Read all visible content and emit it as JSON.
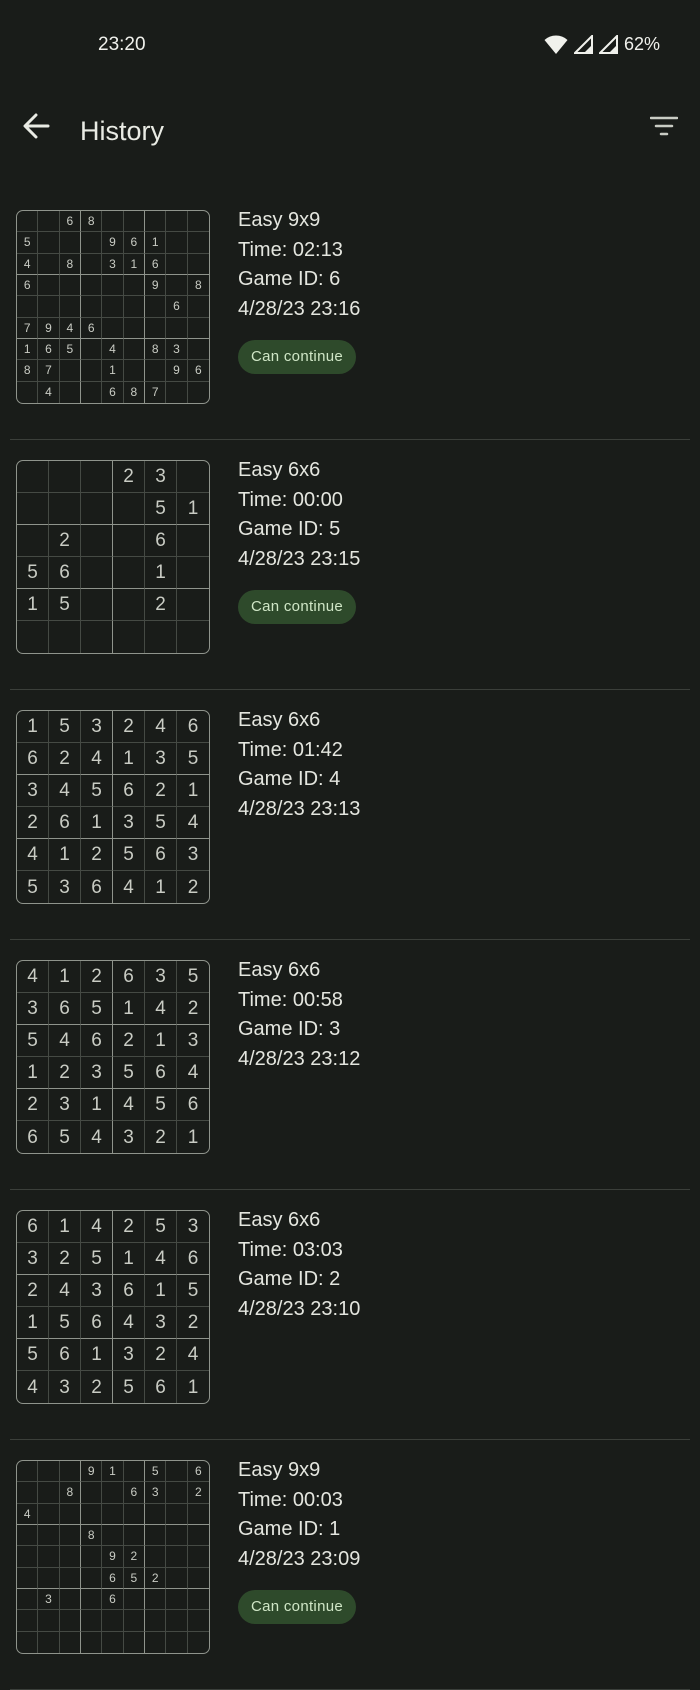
{
  "status_bar": {
    "time": "23:20",
    "battery": "62%"
  },
  "header": {
    "title": "History"
  },
  "icons": {
    "back": "arrow-left-icon",
    "filter": "filter-icon",
    "wifi": "wifi-icon",
    "signal": "cell-signal-icon"
  },
  "colors": {
    "background": "#191c19",
    "continue_button": "#2e4a2b",
    "continue_text": "#cfe6c6"
  },
  "history": [
    {
      "difficulty": "Easy 9x9",
      "time": "Time: 02:13",
      "game_id": "Game ID: 6",
      "date": "4/28/23 23:16",
      "continue_label": "Can continue",
      "size": 9,
      "grid": [
        [
          "",
          "",
          "6",
          "8",
          "",
          "",
          "",
          "",
          ""
        ],
        [
          "5",
          "",
          "",
          "",
          "9",
          "6",
          "1",
          "",
          ""
        ],
        [
          "4",
          "",
          "8",
          "",
          "3",
          "1",
          "6",
          "",
          ""
        ],
        [
          "6",
          "",
          "",
          "",
          "",
          "",
          "9",
          "",
          "8"
        ],
        [
          "",
          "",
          "",
          "",
          "",
          "",
          "",
          "6",
          ""
        ],
        [
          "7",
          "9",
          "4",
          "6",
          "",
          "",
          "",
          "",
          ""
        ],
        [
          "1",
          "6",
          "5",
          "",
          "4",
          "",
          "8",
          "3",
          ""
        ],
        [
          "8",
          "7",
          "",
          "",
          "1",
          "",
          "",
          "9",
          "6"
        ],
        [
          "",
          "4",
          "",
          "",
          "6",
          "8",
          "7",
          "",
          ""
        ]
      ]
    },
    {
      "difficulty": "Easy 6x6",
      "time": "Time: 00:00",
      "game_id": "Game ID: 5",
      "date": "4/28/23 23:15",
      "continue_label": "Can continue",
      "size": 6,
      "grid": [
        [
          "",
          "",
          "",
          "2",
          "3",
          ""
        ],
        [
          "",
          "",
          "",
          "",
          "5",
          "1"
        ],
        [
          "",
          "2",
          "",
          "",
          "6",
          ""
        ],
        [
          "5",
          "6",
          "",
          "",
          "1",
          ""
        ],
        [
          "1",
          "5",
          "",
          "",
          "2",
          ""
        ],
        [
          "",
          "",
          "",
          "",
          "",
          ""
        ]
      ]
    },
    {
      "difficulty": "Easy 6x6",
      "time": "Time: 01:42",
      "game_id": "Game ID: 4",
      "date": "4/28/23 23:13",
      "continue_label": "",
      "size": 6,
      "grid": [
        [
          "1",
          "5",
          "3",
          "2",
          "4",
          "6"
        ],
        [
          "6",
          "2",
          "4",
          "1",
          "3",
          "5"
        ],
        [
          "3",
          "4",
          "5",
          "6",
          "2",
          "1"
        ],
        [
          "2",
          "6",
          "1",
          "3",
          "5",
          "4"
        ],
        [
          "4",
          "1",
          "2",
          "5",
          "6",
          "3"
        ],
        [
          "5",
          "3",
          "6",
          "4",
          "1",
          "2"
        ]
      ]
    },
    {
      "difficulty": "Easy 6x6",
      "time": "Time: 00:58",
      "game_id": "Game ID: 3",
      "date": "4/28/23 23:12",
      "continue_label": "",
      "size": 6,
      "grid": [
        [
          "4",
          "1",
          "2",
          "6",
          "3",
          "5"
        ],
        [
          "3",
          "6",
          "5",
          "1",
          "4",
          "2"
        ],
        [
          "5",
          "4",
          "6",
          "2",
          "1",
          "3"
        ],
        [
          "1",
          "2",
          "3",
          "5",
          "6",
          "4"
        ],
        [
          "2",
          "3",
          "1",
          "4",
          "5",
          "6"
        ],
        [
          "6",
          "5",
          "4",
          "3",
          "2",
          "1"
        ]
      ]
    },
    {
      "difficulty": "Easy 6x6",
      "time": "Time: 03:03",
      "game_id": "Game ID: 2",
      "date": "4/28/23 23:10",
      "continue_label": "",
      "size": 6,
      "grid": [
        [
          "6",
          "1",
          "4",
          "2",
          "5",
          "3"
        ],
        [
          "3",
          "2",
          "5",
          "1",
          "4",
          "6"
        ],
        [
          "2",
          "4",
          "3",
          "6",
          "1",
          "5"
        ],
        [
          "1",
          "5",
          "6",
          "4",
          "3",
          "2"
        ],
        [
          "5",
          "6",
          "1",
          "3",
          "2",
          "4"
        ],
        [
          "4",
          "3",
          "2",
          "5",
          "6",
          "1"
        ]
      ]
    },
    {
      "difficulty": "Easy 9x9",
      "time": "Time: 00:03",
      "game_id": "Game ID: 1",
      "date": "4/28/23 23:09",
      "continue_label": "Can continue",
      "size": 9,
      "grid": [
        [
          "",
          "",
          "",
          "9",
          "1",
          "",
          "5",
          "",
          "6"
        ],
        [
          "",
          "",
          "8",
          "",
          "",
          "6",
          "3",
          "",
          "2"
        ],
        [
          "4",
          "",
          "",
          "",
          "",
          "",
          "",
          "",
          ""
        ],
        [
          "",
          "",
          "",
          "8",
          "",
          "",
          "",
          "",
          ""
        ],
        [
          "",
          "",
          "",
          "",
          "9",
          "2",
          "",
          "",
          ""
        ],
        [
          "",
          "",
          "",
          "",
          "6",
          "5",
          "2",
          "",
          ""
        ],
        [
          "",
          "3",
          "",
          "",
          "6",
          "",
          "",
          "",
          ""
        ],
        [
          "",
          "",
          "",
          "",
          "",
          "",
          "",
          "",
          ""
        ],
        [
          "",
          "",
          "",
          "",
          "",
          "",
          "",
          "",
          ""
        ]
      ]
    }
  ]
}
